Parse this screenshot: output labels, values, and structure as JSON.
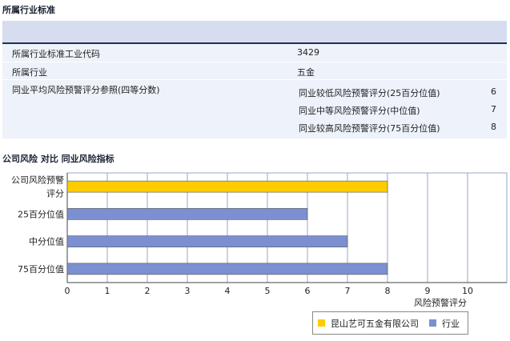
{
  "section1_title": "所属行业标准",
  "info": {
    "code_label": "所属行业标准工业代码",
    "code_value": "3429",
    "industry_label": "所属行业",
    "industry_value": "五金",
    "avg_label": "同业平均风险预警评分参照(四等分数)",
    "benchmarks": [
      {
        "label": "同业较低风险预警评分(25百分位值)",
        "value": "6"
      },
      {
        "label": "同业中等风险预警评分(中位值)",
        "value": "7"
      },
      {
        "label": "同业较高风险预警评分(75百分位值)",
        "value": "8"
      }
    ]
  },
  "section2_title": "公司风险 对比 同业风险指标",
  "chart_data": {
    "type": "bar",
    "orientation": "horizontal",
    "categories": [
      "公司风险预警评分",
      "25百分位值",
      "中分位值",
      "75百分位值"
    ],
    "category_lines": [
      [
        "公司风险预警",
        "评分"
      ],
      [
        "25百分位值"
      ],
      [
        "中分位值"
      ],
      [
        "75百分位值"
      ]
    ],
    "values": [
      8,
      6,
      7,
      8
    ],
    "series_of": [
      0,
      1,
      1,
      1
    ],
    "series": [
      {
        "name": "昆山艺可五金有限公司",
        "color": "#ffcc00"
      },
      {
        "name": "行业",
        "color": "#7b8fd1"
      }
    ],
    "xlim": [
      0,
      11
    ],
    "x_ticks": [
      0,
      1,
      2,
      3,
      4,
      5,
      6,
      7,
      8,
      9,
      10
    ],
    "xlabel": "风险预警评分",
    "grid": true,
    "legend_position": "bottom-right"
  },
  "colors": {
    "header_band": "#d5ddef",
    "row_bg": "#eef2fa",
    "header_line": "#1f2f55"
  }
}
